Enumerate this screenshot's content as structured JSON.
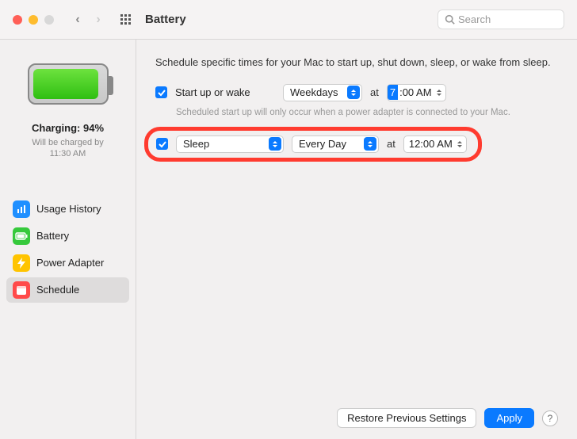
{
  "title": "Battery",
  "search_placeholder": "Search",
  "sidebar": {
    "charge_label": "Charging: 94%",
    "charge_sub1": "Will be charged by",
    "charge_sub2": "11:30 AM",
    "items": [
      {
        "label": "Usage History"
      },
      {
        "label": "Battery"
      },
      {
        "label": "Power Adapter"
      },
      {
        "label": "Schedule"
      }
    ]
  },
  "main": {
    "description": "Schedule specific times for your Mac to start up, shut down, sleep, or wake from sleep.",
    "row1": {
      "label": "Start up or wake",
      "freq": "Weekdays",
      "at": "at",
      "time_h": "7",
      "time_rest": ":00 AM"
    },
    "note": "Scheduled start up will only occur when a power adapter is connected to your Mac.",
    "row2": {
      "action": "Sleep",
      "freq": "Every Day",
      "at": "at",
      "time": "12:00 AM"
    }
  },
  "footer": {
    "restore": "Restore Previous Settings",
    "apply": "Apply",
    "help": "?"
  }
}
